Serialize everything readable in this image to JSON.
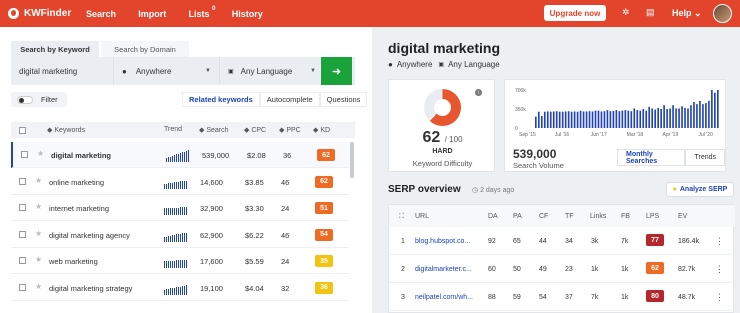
{
  "topbar": {
    "logo": "KWFinder",
    "nav": [
      "Search",
      "Import",
      "Lists",
      "History"
    ],
    "lists_badge": "0",
    "upgrade": "Upgrade now",
    "help": "Help"
  },
  "left": {
    "tabs": [
      "Search by Keyword",
      "Search by Domain"
    ],
    "keyword": "digital marketing",
    "location": "Anywhere",
    "language": "Any Language",
    "go_icon": "arrow-right-icon",
    "filter": "Filter",
    "subtabs": [
      "Related keywords",
      "Autocomplete",
      "Questions"
    ],
    "columns": [
      "Keywords",
      "Trend",
      "Search",
      "CPC",
      "PPC",
      "KD"
    ],
    "rows": [
      {
        "keyword": "digital marketing",
        "search": "539,000",
        "cpc": "$2.08",
        "ppc": "36",
        "kd": "62",
        "kd_color": "#ef6a22",
        "selected": true,
        "trend": [
          4,
          5,
          5,
          6,
          7,
          8,
          8,
          9,
          10,
          10,
          11,
          12
        ]
      },
      {
        "keyword": "online marketing",
        "search": "14,600",
        "cpc": "$3.85",
        "ppc": "46",
        "kd": "62",
        "kd_color": "#ef6a22",
        "selected": false,
        "trend": [
          5,
          5,
          6,
          6,
          6,
          7,
          7,
          7,
          8,
          8,
          8,
          8
        ]
      },
      {
        "keyword": "internet marketing",
        "search": "32,900",
        "cpc": "$3.30",
        "ppc": "24",
        "kd": "51",
        "kd_color": "#ef6a22",
        "selected": false,
        "trend": [
          7,
          7,
          7,
          7,
          7,
          7,
          7,
          7,
          8,
          8,
          8,
          8
        ]
      },
      {
        "keyword": "digital marketing agency",
        "search": "62,900",
        "cpc": "$6.22",
        "ppc": "46",
        "kd": "54",
        "kd_color": "#ef6a22",
        "selected": false,
        "trend": [
          5,
          5,
          6,
          6,
          7,
          7,
          8,
          8,
          8,
          9,
          9,
          9
        ]
      },
      {
        "keyword": "web marketing",
        "search": "17,600",
        "cpc": "$5.59",
        "ppc": "24",
        "kd": "35",
        "kd_color": "#f2c411",
        "selected": false,
        "trend": [
          7,
          7,
          7,
          7,
          7,
          7,
          8,
          8,
          8,
          8,
          8,
          8
        ]
      },
      {
        "keyword": "digital marketing strategy",
        "search": "19,100",
        "cpc": "$4.04",
        "ppc": "32",
        "kd": "36",
        "kd_color": "#f2c411",
        "selected": false,
        "trend": [
          5,
          6,
          6,
          7,
          7,
          7,
          8,
          8,
          8,
          9,
          9,
          10
        ]
      }
    ]
  },
  "right": {
    "title": "digital marketing",
    "location": "Anywhere",
    "language": "Any Language",
    "kd_value": "62",
    "kd_max": "/ 100",
    "kd_level": "HARD",
    "kd_label": "Keyword Difficulty",
    "kd_percent": 62,
    "volume": "539,000",
    "volume_label": "Search Volume",
    "volume_modes": [
      "Monthly Searches",
      "Trends"
    ],
    "serp_title": "SERP overview",
    "serp_age": "2 days ago",
    "analyze_button": "Analyze SERP",
    "serp_columns": [
      "URL",
      "DA",
      "PA",
      "CF",
      "TF",
      "Links",
      "FB",
      "LPS",
      "EV"
    ],
    "serp_rows": [
      {
        "rank": "1",
        "url": "blog.hubspot.co...",
        "da": "92",
        "pa": "65",
        "cf": "44",
        "tf": "34",
        "links": "3k",
        "fb": "7k",
        "lps": "77",
        "lps_color": "#b4272b",
        "ev": "186.4k"
      },
      {
        "rank": "2",
        "url": "digitalmarketer.c...",
        "da": "60",
        "pa": "50",
        "cf": "49",
        "tf": "23",
        "links": "1k",
        "fb": "1k",
        "lps": "62",
        "lps_color": "#ef6a22",
        "ev": "82.7k"
      },
      {
        "rank": "3",
        "url": "neilpatel.com/wh...",
        "da": "88",
        "pa": "59",
        "cf": "54",
        "tf": "37",
        "links": "7k",
        "fb": "1k",
        "lps": "80",
        "lps_color": "#b4272b",
        "ev": "48.7k"
      }
    ]
  },
  "chart_data": {
    "type": "bar",
    "ytick_labels": [
      "700k",
      "350k",
      "0"
    ],
    "xtick_labels": [
      "Sep '15",
      "Jul '16",
      "Jun '17",
      "Mar '18",
      "Apr '19",
      "Jul '20"
    ],
    "ylim": [
      0,
      700000
    ],
    "values": [
      210000,
      300000,
      220000,
      300000,
      305000,
      300000,
      305000,
      310000,
      300000,
      300000,
      305000,
      310000,
      300000,
      305000,
      300000,
      320000,
      305000,
      305000,
      310000,
      305000,
      320000,
      320000,
      305000,
      310000,
      330000,
      310000,
      315000,
      330000,
      310000,
      320000,
      330000,
      320000,
      310000,
      360000,
      330000,
      320000,
      350000,
      320000,
      390000,
      360000,
      340000,
      370000,
      350000,
      420000,
      350000,
      360000,
      420000,
      360000,
      360000,
      400000,
      370000,
      360000,
      420000,
      480000,
      440000,
      500000,
      440000,
      460000,
      500000,
      700000,
      650000,
      700000
    ]
  }
}
